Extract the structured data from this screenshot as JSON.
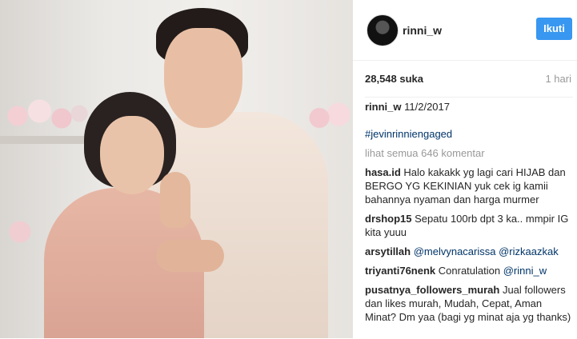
{
  "post": {
    "username": "rinni_w",
    "follow_label": "Ikuti",
    "likes": "28,548 suka",
    "time": "1 hari"
  },
  "caption": {
    "user": "rinni_w",
    "text": " 11/2/2017",
    "line2": "",
    "hashtag": "#jevinrinniengaged"
  },
  "view_all": "lihat semua 646 komentar",
  "comments": [
    {
      "user": "hasa.id",
      "text": " Halo kakakk yg lagi cari HIJAB dan BERGO YG KEKINIAN yuk cek ig kamii bahannya nyaman dan harga murmer"
    },
    {
      "user": "drshop15",
      "text": " Sepatu 100rb dpt 3 ka.. mmpir IG kita yuuu"
    },
    {
      "user": "arsytillah",
      "mention": " @melvynacarissa @rizkaazkak"
    },
    {
      "user": "triyanti76nenk",
      "text": " Conratulation ",
      "mention": "@rinni_w"
    },
    {
      "user": "pusatnya_followers_murah",
      "text": " Jual followers dan likes murah, Mudah, Cepat, Aman Minat? Dm yaa (bagi yg minat aja yg thanks)"
    }
  ]
}
